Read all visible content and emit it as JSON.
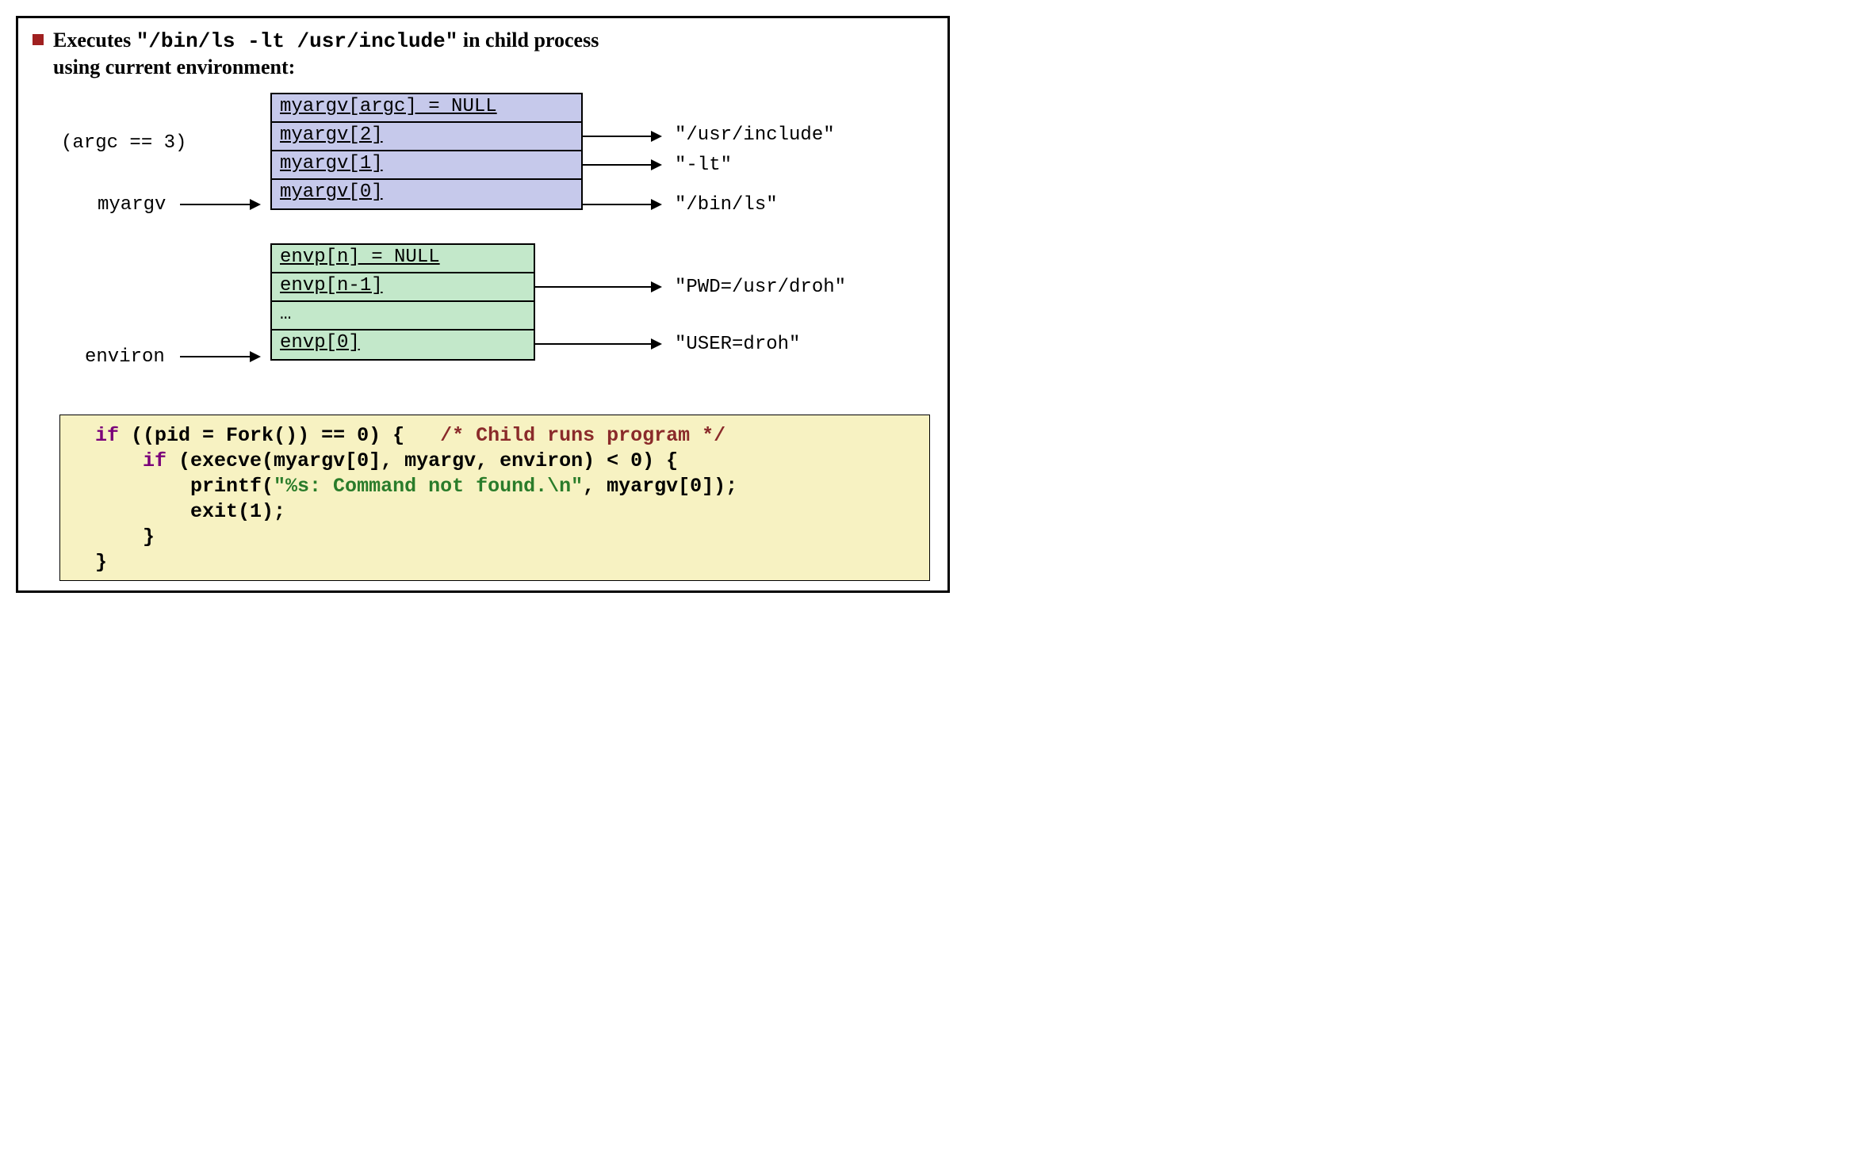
{
  "headline": {
    "pre": "Executes ",
    "cmd": "\"/bin/ls -lt /usr/include\"",
    "mid": " in child process ",
    "post": "using current environment:"
  },
  "argc_label": "(argc == 3)",
  "myargv_label": "myargv",
  "environ_label": "environ",
  "argv_cells": {
    "c0": "myargv[argc]  = NULL",
    "c1": "myargv[2]",
    "c2": "myargv[1]",
    "c3": "myargv[0]"
  },
  "argv_targets": {
    "t1": "\"/usr/include\"",
    "t2": "\"-lt\"",
    "t3": "\"/bin/ls\""
  },
  "envp_cells": {
    "c0": "envp[n]  = NULL",
    "c1": "envp[n-1]",
    "c2": "…",
    "c3": "envp[0]"
  },
  "envp_targets": {
    "t1": "\"PWD=/usr/droh\"",
    "t3": "\"USER=droh\""
  },
  "code": {
    "l1a": "  ",
    "l1_if": "if",
    "l1b": " ((pid = Fork()) == 0) {   ",
    "l1_cm": "/* Child runs program */",
    "l2a": "      ",
    "l2_if": "if",
    "l2b": " (execve(myargv[0], myargv, environ) < 0) {",
    "l3a": "          printf(",
    "l3_str": "\"%s: Command not found.\\n\"",
    "l3b": ", myargv[0]);",
    "l4": "          exit(1);",
    "l5": "      }",
    "l6": "  }"
  }
}
